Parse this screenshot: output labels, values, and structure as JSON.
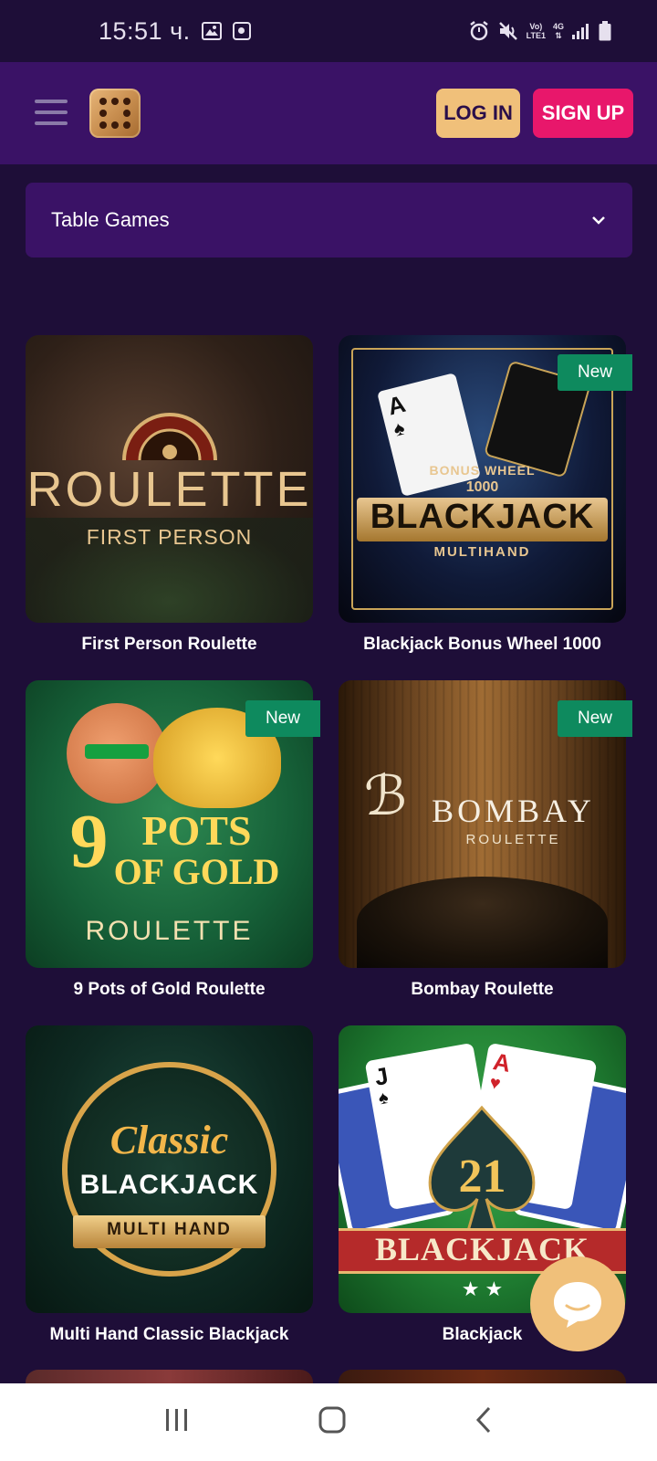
{
  "status_bar": {
    "time": "15:51 ч.",
    "volte_line1": "Vo)",
    "volte_line2": "LTE1",
    "network": "4G"
  },
  "header": {
    "login_label": "LOG IN",
    "signup_label": "SIGN UP"
  },
  "category": {
    "selected": "Table Games"
  },
  "badge_label": "New",
  "games": [
    {
      "title": "First Person Roulette",
      "art_line1": "ROULETTE",
      "art_line2": "FIRST PERSON",
      "is_new": false
    },
    {
      "title": "Blackjack Bonus Wheel 1000",
      "art_line1": "BONUS WHEEL",
      "art_line1b": "1000",
      "art_line2": "BLACKJACK",
      "art_line3": "MULTIHAND",
      "is_new": true
    },
    {
      "title": "9 Pots of Gold Roulette",
      "art_line1": "9",
      "art_line1b": "POTS",
      "art_line1c": "OF GOLD",
      "art_line2": "ROULETTE",
      "is_new": true
    },
    {
      "title": "Bombay Roulette",
      "art_line1": "BOMBAY",
      "art_line2": "ROULETTE",
      "is_new": true
    },
    {
      "title": "Multi Hand Classic Blackjack",
      "art_line1": "Classic",
      "art_line2": "BLACKJACK",
      "art_line3": "MULTI HAND",
      "is_new": false
    },
    {
      "title": "Blackjack",
      "art_line1": "21",
      "art_line2": "BLACKJACK",
      "is_new": false
    }
  ],
  "colors": {
    "background": "#1e0e38",
    "header": "#3a1266",
    "login": "#f0c07a",
    "signup": "#e8176b",
    "badge": "#0e8a5e"
  }
}
